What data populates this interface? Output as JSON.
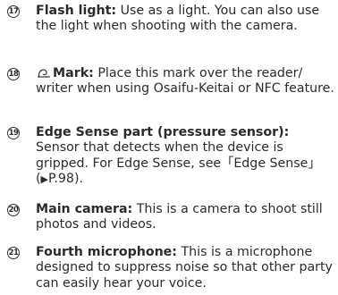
{
  "items": [
    {
      "number": "17",
      "term": "Flash light:",
      "text": " Use as a light. You can also use the light when shooting with the camera."
    },
    {
      "number": "18",
      "term": "Mark:",
      "text": " Place this mark over the reader/ writer when using Osaifu-Keitai or NFC feature.",
      "icon": "nfc-mark-icon"
    },
    {
      "number": "19",
      "term": "Edge Sense part (pressure sensor):",
      "text": " Sensor that detects when the device is gripped. For Edge Sense, see「Edge Sense」(",
      "arrow": "▶",
      "ref": "P.98",
      "text_end": ")."
    },
    {
      "number": "20",
      "term": "Main camera:",
      "text": " This is a camera to shoot still photos and videos."
    },
    {
      "number": "21",
      "term": "Fourth microphone:",
      "text": " This is a microphone designed to suppress noise so that other party can easily hear your voice."
    }
  ]
}
